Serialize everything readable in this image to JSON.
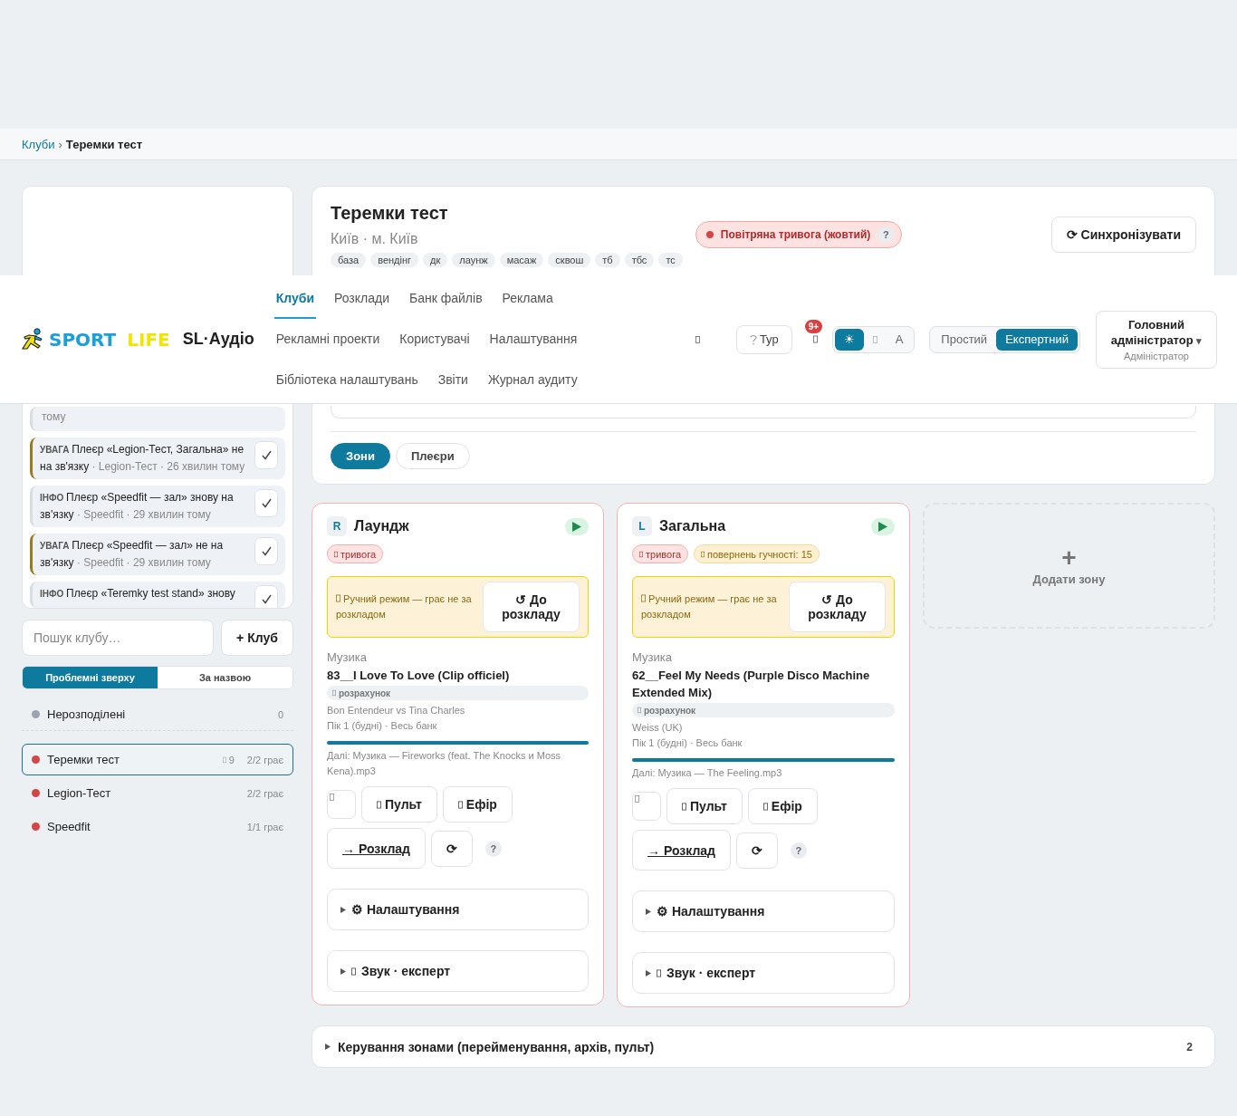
{
  "breadcrumb": {
    "items": [
      {
        "label": "Клуби",
        "link": true
      },
      {
        "label": "Теремки тест",
        "link": false
      }
    ],
    "separator": "›"
  },
  "header": {
    "logo": {
      "words": [
        "SPORT",
        "LIFE"
      ]
    },
    "app_name": "SL·Аудіо",
    "nav": [
      {
        "label": "Клуби",
        "selected": true
      },
      {
        "label": "Розклади",
        "selected": false
      },
      {
        "label": "Банк файлів",
        "selected": false
      },
      {
        "label": "Реклама",
        "selected": false
      },
      {
        "label": "Рекламні проекти",
        "selected": false
      },
      {
        "label": "Користувачі",
        "selected": false
      },
      {
        "label": "Налаштування",
        "selected": false
      },
      {
        "label": "Бібліотека налаштувань",
        "selected": false
      },
      {
        "label": "Звіти",
        "selected": false
      },
      {
        "label": "Журнал аудиту",
        "selected": false
      }
    ],
    "tour": "Тур",
    "notifications_badge": "9+",
    "theme_options": [
      {
        "kind": "text",
        "label": "☀",
        "selected": true
      },
      {
        "kind": "glyph",
        "selected": false
      },
      {
        "kind": "text",
        "label": "A",
        "selected": false
      }
    ],
    "modes": [
      {
        "label": "Простий",
        "selected": false
      },
      {
        "label": "Експертний",
        "selected": true
      }
    ],
    "user": {
      "name": "Головний адміністратор",
      "caret": "▾",
      "role": "Адміністратор"
    }
  },
  "club": {
    "title": "Теремки тест",
    "location": "Київ · м. Київ",
    "tags": [
      "база",
      "вендінг",
      "дк",
      "лаунж",
      "масаж",
      "сквош",
      "тб",
      "тбс",
      "тс"
    ],
    "alert": {
      "label": "Повітряна тривога (жовтий)",
      "help": "?"
    },
    "sync": "⟳ Синхронізувати",
    "view_tabs": [
      {
        "label": "Зони",
        "selected": true
      },
      {
        "label": "Плеєри",
        "selected": false
      }
    ]
  },
  "notifications": [
    {
      "kind": "tail",
      "meta": "тому"
    },
    {
      "kind": "warning",
      "level": "УВАГА",
      "message": "Плеєр «Legion-Тест, Загальна» не на зв'язку",
      "meta": " · Legion-Тест · 26 хвилин тому"
    },
    {
      "kind": "info",
      "level": "ІНФО",
      "message": "Плеєр «Speedfit — зал» знову на зв'язку",
      "meta": " · Speedfit · 29 хвилин тому"
    },
    {
      "kind": "warning",
      "level": "УВАГА",
      "message": "Плеєр «Speedfit — зал» не на зв'язку",
      "meta": " · Speedfit · 29 хвилин тому"
    },
    {
      "kind": "info",
      "level": "ІНФО",
      "message": "Плеєр «Teremky test stand» знову",
      "cut": true
    }
  ],
  "club_search": {
    "placeholder": "Пошук клубу…"
  },
  "add_club": "+ Клуб",
  "sort": [
    {
      "label": "Проблемні зверху",
      "selected": true
    },
    {
      "label": "За назвою",
      "selected": false
    }
  ],
  "clubs": [
    {
      "kind": "group",
      "name": "Нерозподілені",
      "color": "#9aa5b1",
      "count": "0",
      "selected": false
    },
    {
      "kind": "club",
      "name": "Теремки тест",
      "color": "#d64545",
      "players": "9",
      "status": "2/2 грає",
      "selected": true
    },
    {
      "kind": "club",
      "name": "Legion-Тест",
      "color": "#d64545",
      "status": "2/2 грає",
      "selected": false
    },
    {
      "kind": "club",
      "name": "Speedfit",
      "color": "#d64545",
      "status": "1/1 грає",
      "selected": false
    }
  ],
  "zones": [
    {
      "badge": "R",
      "name": "Лаундж",
      "playing": true,
      "tags": [
        {
          "kind": "alert",
          "label": "тривога"
        }
      ],
      "manual": {
        "text": "Ручний режим — грає не за розкладом",
        "button": "↺ До розкладу"
      },
      "category": "Музика",
      "track": "83__I Love To Love (Clip officiel)",
      "source": "розрахунок",
      "artist": "Bon Entendeur vs Tina Charles",
      "slot": "Пік 1 (будні) · Весь банк",
      "level": 1,
      "next": "Далі: Музика — Fireworks (feat. The Knocks и Moss Kena).mp3",
      "actions": [
        "Пульт",
        "Ефір"
      ],
      "schedule": "→ Розклад",
      "refresh": "⟳",
      "help": "?",
      "sections": [
        {
          "label": "⚙ Налаштування",
          "glyph": false
        },
        {
          "label": "Звук · експерт",
          "glyph": true
        }
      ]
    },
    {
      "badge": "L",
      "name": "Загальна",
      "playing": true,
      "tags": [
        {
          "kind": "alert",
          "label": "тривога"
        },
        {
          "kind": "warning",
          "label": "повернень гучності: 15"
        }
      ],
      "manual": {
        "text": "Ручний режим — грає не за розкладом",
        "button": "↺ До розкладу"
      },
      "category": "Музика",
      "track": "62__Feel My Needs (Purple Disco Machine Extended Mix)",
      "source": "розрахунок",
      "artist": "Weiss (UK)",
      "slot": "Пік 1 (будні) · Весь банк",
      "level": 1,
      "next": "Далі: Музика — The Feeling.mp3",
      "actions": [
        "Пульт",
        "Ефір"
      ],
      "schedule": "→ Розклад",
      "refresh": "⟳",
      "help": "?",
      "sections": [
        {
          "label": "⚙ Налаштування",
          "glyph": false
        },
        {
          "label": "Звук · експерт",
          "glyph": true
        }
      ]
    }
  ],
  "add_zone": {
    "plus": "+",
    "label": "Додати зону"
  },
  "zone_management": {
    "label": "Керування зонами (перейменування, архів, пульт)",
    "count": "2"
  }
}
